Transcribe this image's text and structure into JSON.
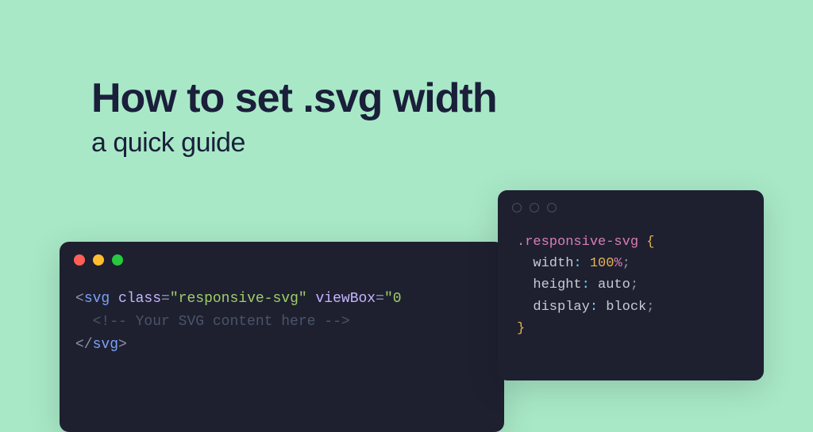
{
  "heading": {
    "title": "How to set .svg width",
    "subtitle": "a quick guide"
  },
  "codeLeft": {
    "line1": {
      "open": "<",
      "tag": "svg",
      "sp": " ",
      "attr1": "class",
      "eq": "=",
      "val1": "\"responsive-svg\"",
      "attr2": "viewBox",
      "val2": "\"0"
    },
    "line2": {
      "open": "<!--",
      "text": " Your SVG content here ",
      "close": "-->"
    },
    "line3": {
      "open": "</",
      "tag": "svg",
      "close": ">"
    }
  },
  "codeRight": {
    "selector": ".responsive-svg",
    "braceOpen": " {",
    "prop1": "width",
    "val1_num": "100",
    "val1_unit": "%",
    "prop2": "height",
    "val2": "auto",
    "prop3": "display",
    "val3": "block",
    "braceClose": "}",
    "colon": ": ",
    "semi": ";"
  }
}
